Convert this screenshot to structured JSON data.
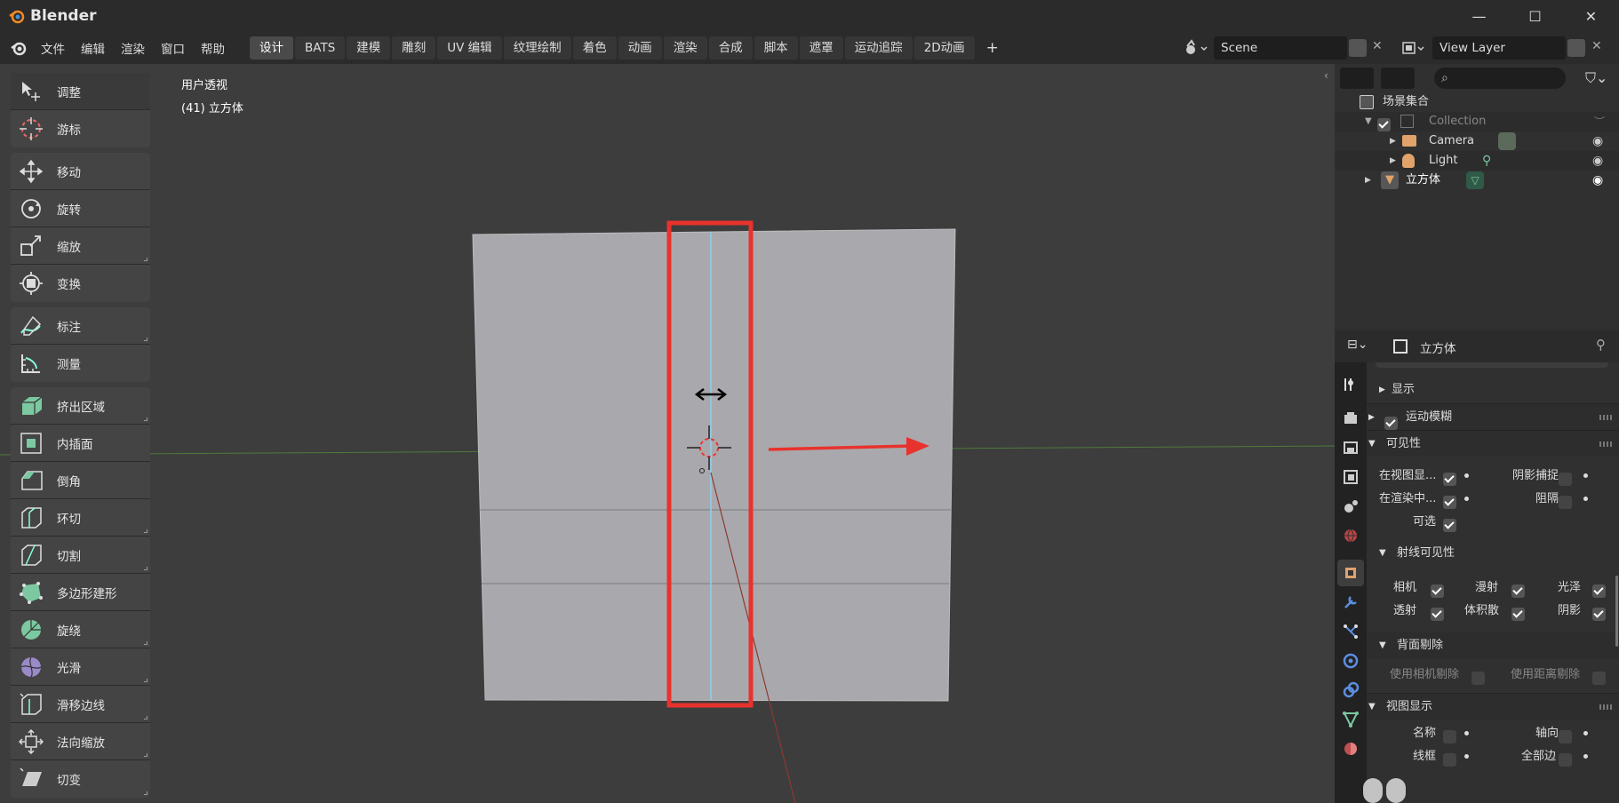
{
  "window": {
    "title": "Blender",
    "minimize": "—",
    "maximize": "☐",
    "close": "✕"
  },
  "menu": [
    "文件",
    "编辑",
    "渲染",
    "窗口",
    "帮助"
  ],
  "workspaces": [
    "设计",
    "BATS",
    "建模",
    "雕刻",
    "UV 编辑",
    "纹理绘制",
    "着色",
    "动画",
    "渲染",
    "合成",
    "脚本",
    "遮罩",
    "运动追踪",
    "2D动画"
  ],
  "workspace_add": "+",
  "scene": {
    "value": "Scene"
  },
  "view_layer": {
    "value": "View Layer"
  },
  "viewport": {
    "view_name": "用户透视",
    "object_info": "(41) 立方体"
  },
  "tools": {
    "group1": [
      "调整",
      "游标"
    ],
    "group2": [
      "移动",
      "旋转",
      "缩放",
      "变换"
    ],
    "group3": [
      "标注",
      "测量"
    ],
    "group4": [
      "挤出区域",
      "内插面",
      "倒角",
      "环切",
      "切割",
      "多边形建形",
      "旋绕",
      "光滑",
      "滑移边线",
      "法向缩放",
      "切变"
    ]
  },
  "outliner": {
    "scene_collection": "场景集合",
    "collection": "Collection",
    "camera": "Camera",
    "light": "Light",
    "cube": "立方体"
  },
  "properties": {
    "object_name": "立方体",
    "display": "显示",
    "motion_blur": "运动模糊",
    "visibility": "可见性",
    "show_in_viewport": "在视图显...",
    "shadow_catcher": "阴影捕捉",
    "show_in_render": "在渲染中...",
    "holdout": "阻隔",
    "selectable": "可选",
    "ray_visibility": "射线可见性",
    "camera": "相机",
    "diffuse": "漫射",
    "glossy": "光泽",
    "transmission": "透射",
    "volume_scatter": "体积散",
    "shadow": "阴影",
    "culling": "背面剔除",
    "use_camera_cull": "使用相机剔除",
    "use_distance_cull": "使用距离剔除",
    "viewport_display": "视图显示",
    "name": "名称",
    "axis": "轴向",
    "wireframe": "线框",
    "all_edges": "全部边"
  },
  "colors": {
    "accent": "#e8322d",
    "title_bg": "#2b2b2b",
    "viewport_bg": "#3d3d3d",
    "cube": "#a9a9ad"
  }
}
